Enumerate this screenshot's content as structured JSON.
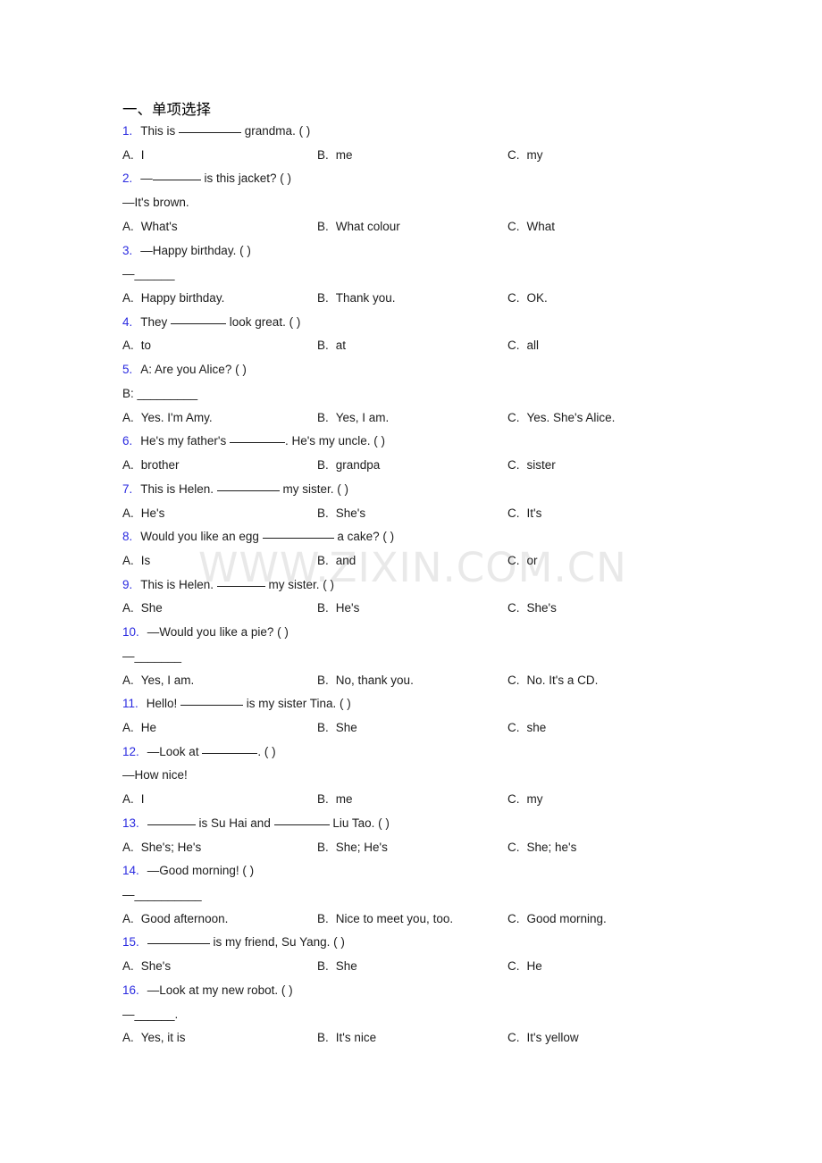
{
  "document": {
    "section_title": "一、单项选择",
    "watermark": "WWW.ZIXIN.COM.CN",
    "number_color": "#2a2ae0",
    "text_color": "#1c1c1c",
    "watermark_color": "#e9e9e9",
    "background_color": "#ffffff"
  },
  "questions": [
    {
      "num": "1.",
      "stem_pre": "This is ",
      "stem_post": " grandma. (  )",
      "blank": "b-xl",
      "extra_lines": [],
      "options": [
        {
          "label": "A.",
          "text": "I"
        },
        {
          "label": "B.",
          "text": "me"
        },
        {
          "label": "C.",
          "text": "my"
        }
      ]
    },
    {
      "num": "2.",
      "stem_pre": "—",
      "stem_post": " is this jacket? (   )",
      "blank": "b-md",
      "extra_lines": [
        "—It's brown."
      ],
      "options": [
        {
          "label": "A.",
          "text": "What's"
        },
        {
          "label": "B.",
          "text": "What colour"
        },
        {
          "label": "C.",
          "text": "What"
        }
      ]
    },
    {
      "num": "3.",
      "stem_pre": "—Happy birthday. (  )",
      "stem_post": "",
      "blank": "",
      "extra_lines": [
        "—______"
      ],
      "options": [
        {
          "label": "A.",
          "text": "Happy birthday."
        },
        {
          "label": "B.",
          "text": "Thank you."
        },
        {
          "label": "C.",
          "text": "OK."
        }
      ]
    },
    {
      "num": "4.",
      "stem_pre": "They ",
      "stem_post": " look great. (  )",
      "blank": "b-lg",
      "extra_lines": [],
      "options": [
        {
          "label": "A.",
          "text": "to"
        },
        {
          "label": "B.",
          "text": "at"
        },
        {
          "label": "C.",
          "text": "all"
        }
      ]
    },
    {
      "num": "5.",
      "stem_pre": "A: Are you Alice?  (    )",
      "stem_post": "",
      "blank": "",
      "extra_lines": [
        "B: _________"
      ],
      "options": [
        {
          "label": "A.",
          "text": "Yes. I'm Amy."
        },
        {
          "label": "B.",
          "text": "Yes, I am."
        },
        {
          "label": "C.",
          "text": "Yes. She's Alice."
        }
      ]
    },
    {
      "num": "6.",
      "stem_pre": "He's my father's ",
      "stem_post": ". He's my uncle. (   )",
      "blank": "b-lg",
      "extra_lines": [],
      "options": [
        {
          "label": "A.",
          "text": "brother"
        },
        {
          "label": "B.",
          "text": "grandpa"
        },
        {
          "label": "C.",
          "text": "sister"
        }
      ]
    },
    {
      "num": "7.",
      "stem_pre": "This is Helen. ",
      "stem_post": " my sister. (  )",
      "blank": "b-xl",
      "extra_lines": [],
      "options": [
        {
          "label": "A.",
          "text": "He's"
        },
        {
          "label": "B.",
          "text": "She's"
        },
        {
          "label": "C.",
          "text": "It's"
        }
      ]
    },
    {
      "num": "8.",
      "stem_pre": "Would you like an egg ",
      "stem_post": " a cake? (   )",
      "blank": "b-xxl",
      "extra_lines": [],
      "options": [
        {
          "label": "A.",
          "text": "Is"
        },
        {
          "label": "B.",
          "text": "and"
        },
        {
          "label": "C.",
          "text": "or"
        }
      ]
    },
    {
      "num": "9.",
      "stem_pre": "This is Helen. ",
      "stem_post": " my sister. (  )",
      "blank": "b-md",
      "extra_lines": [],
      "options": [
        {
          "label": "A.",
          "text": "She"
        },
        {
          "label": "B.",
          "text": "He's"
        },
        {
          "label": "C.",
          "text": "She's"
        }
      ]
    },
    {
      "num": "10.",
      "stem_pre": "—Would you like a pie? (  )",
      "stem_post": "",
      "blank": "",
      "extra_lines": [
        "—_______"
      ],
      "options": [
        {
          "label": "A.",
          "text": "Yes, I am."
        },
        {
          "label": "B.",
          "text": "No, thank you."
        },
        {
          "label": "C.",
          "text": "No. It's a CD."
        }
      ]
    },
    {
      "num": "11.",
      "stem_pre": "Hello! ",
      "stem_post": " is my sister Tina. (  )",
      "blank": "b-xl",
      "extra_lines": [],
      "options": [
        {
          "label": "A.",
          "text": "He"
        },
        {
          "label": "B.",
          "text": "She"
        },
        {
          "label": "C.",
          "text": "she"
        }
      ]
    },
    {
      "num": "12.",
      "stem_pre": "—Look at ",
      "stem_post": ". (  )",
      "blank": "b-lg",
      "extra_lines": [
        "—How nice!"
      ],
      "options": [
        {
          "label": "A.",
          "text": "I"
        },
        {
          "label": "B.",
          "text": "me"
        },
        {
          "label": "C.",
          "text": "my"
        }
      ]
    },
    {
      "num": "13.",
      "stem_pre": "",
      "stem_mid": " is Su Hai and ",
      "stem_post": " Liu Tao. (  )",
      "blank": "b-md",
      "blank2": "b-lg",
      "extra_lines": [],
      "options": [
        {
          "label": "A.",
          "text": "She's; He's"
        },
        {
          "label": "B.",
          "text": "She; He's"
        },
        {
          "label": "C.",
          "text": "She; he's"
        }
      ]
    },
    {
      "num": "14.",
      "stem_pre": "—Good morning! (  )",
      "stem_post": "",
      "blank": "",
      "extra_lines": [
        "—__________"
      ],
      "options": [
        {
          "label": "A.",
          "text": "Good afternoon."
        },
        {
          "label": "B.",
          "text": "Nice to meet you, too."
        },
        {
          "label": "C.",
          "text": "Good morning."
        }
      ]
    },
    {
      "num": "15.",
      "stem_pre": "",
      "stem_post": " is my friend, Su Yang. (  )",
      "blank": "b-xl",
      "extra_lines": [],
      "options": [
        {
          "label": "A.",
          "text": "She's"
        },
        {
          "label": "B.",
          "text": "She"
        },
        {
          "label": "C.",
          "text": "He"
        }
      ]
    },
    {
      "num": "16.",
      "stem_pre": "—Look at my new robot. (  )",
      "stem_post": "",
      "blank": "",
      "extra_lines": [
        "—______."
      ],
      "options": [
        {
          "label": "A.",
          "text": "Yes, it is"
        },
        {
          "label": "B.",
          "text": "It's nice"
        },
        {
          "label": "C.",
          "text": "It's yellow"
        }
      ]
    }
  ]
}
